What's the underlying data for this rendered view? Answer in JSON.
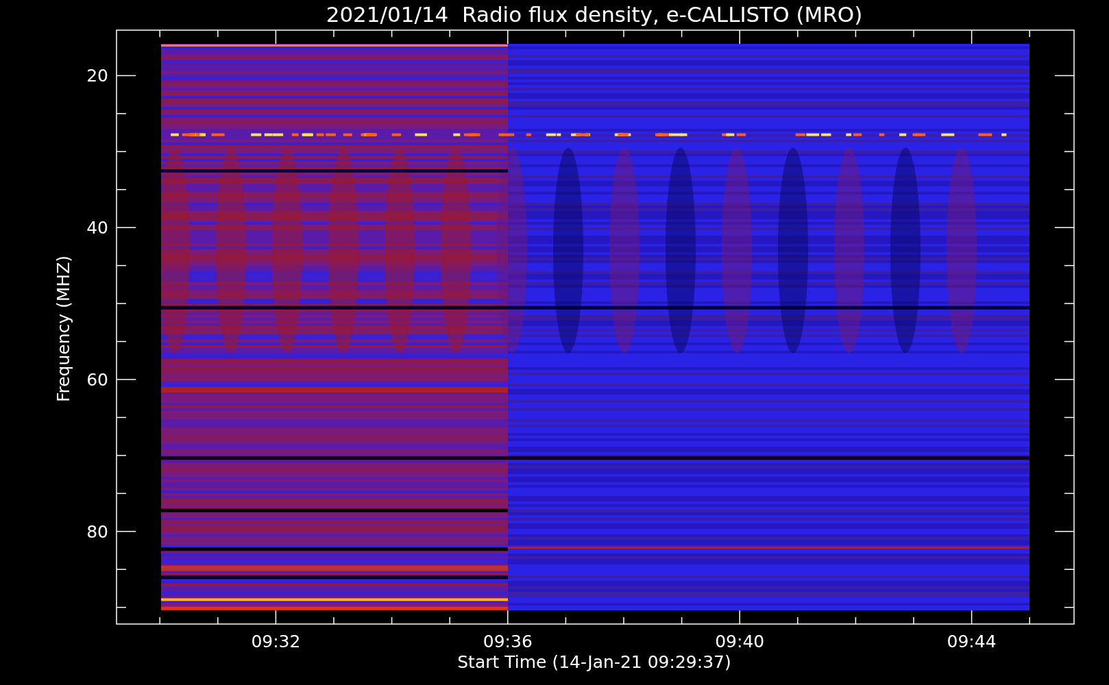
{
  "title": "2021/01/14  Radio flux density, e-CALLISTO (MRO)",
  "y_axis": {
    "label": "Frequency (MHZ)",
    "ticks": [
      "20",
      "40",
      "60",
      "80"
    ]
  },
  "x_axis": {
    "label": "Start Time (14-Jan-21 09:29:37)",
    "ticks": [
      "09:32",
      "09:36",
      "09:40",
      "09:44"
    ]
  }
}
